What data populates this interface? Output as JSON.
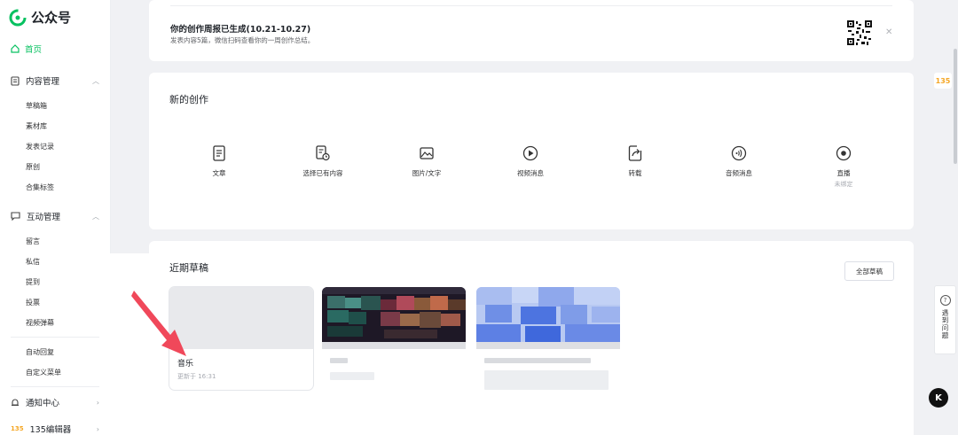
{
  "app": {
    "name": "公众号"
  },
  "sidebar": {
    "home": "首页",
    "content_mgmt": {
      "label": "内容管理",
      "items": [
        "草稿箱",
        "素材库",
        "发表记录",
        "原创",
        "合集标签"
      ]
    },
    "interaction_mgmt": {
      "label": "互动管理",
      "items": [
        "留言",
        "私信",
        "提到",
        "投票",
        "视频弹幕"
      ]
    },
    "extra_items": [
      "自动回复",
      "自定义菜单"
    ],
    "notification": "通知中心",
    "editor": "135编辑器"
  },
  "notice": {
    "title": "你的创作周报已生成(10.21-10.27)",
    "subtitle": "发表内容5篇，微信扫码查看你的一周创作总结。"
  },
  "create": {
    "title": "新的创作",
    "items": [
      {
        "label": "文章",
        "icon": "doc-icon"
      },
      {
        "label": "选择已有内容",
        "icon": "select-existing-icon"
      },
      {
        "label": "图片/文字",
        "icon": "image-text-icon"
      },
      {
        "label": "视频消息",
        "icon": "video-icon"
      },
      {
        "label": "转载",
        "icon": "repost-icon"
      },
      {
        "label": "音频消息",
        "icon": "audio-icon"
      },
      {
        "label": "直播",
        "sublabel": "未绑定",
        "icon": "live-icon"
      }
    ]
  },
  "drafts": {
    "title": "近期草稿",
    "all_button": "全部草稿",
    "items": [
      {
        "title": "音乐",
        "time": "更新于 16:31"
      }
    ]
  },
  "right_panel": {
    "help_text": "遇到问题",
    "tool_label": "135",
    "k_label": "K"
  },
  "colors": {
    "accent": "#07c160",
    "arrow": "#f0485a"
  }
}
